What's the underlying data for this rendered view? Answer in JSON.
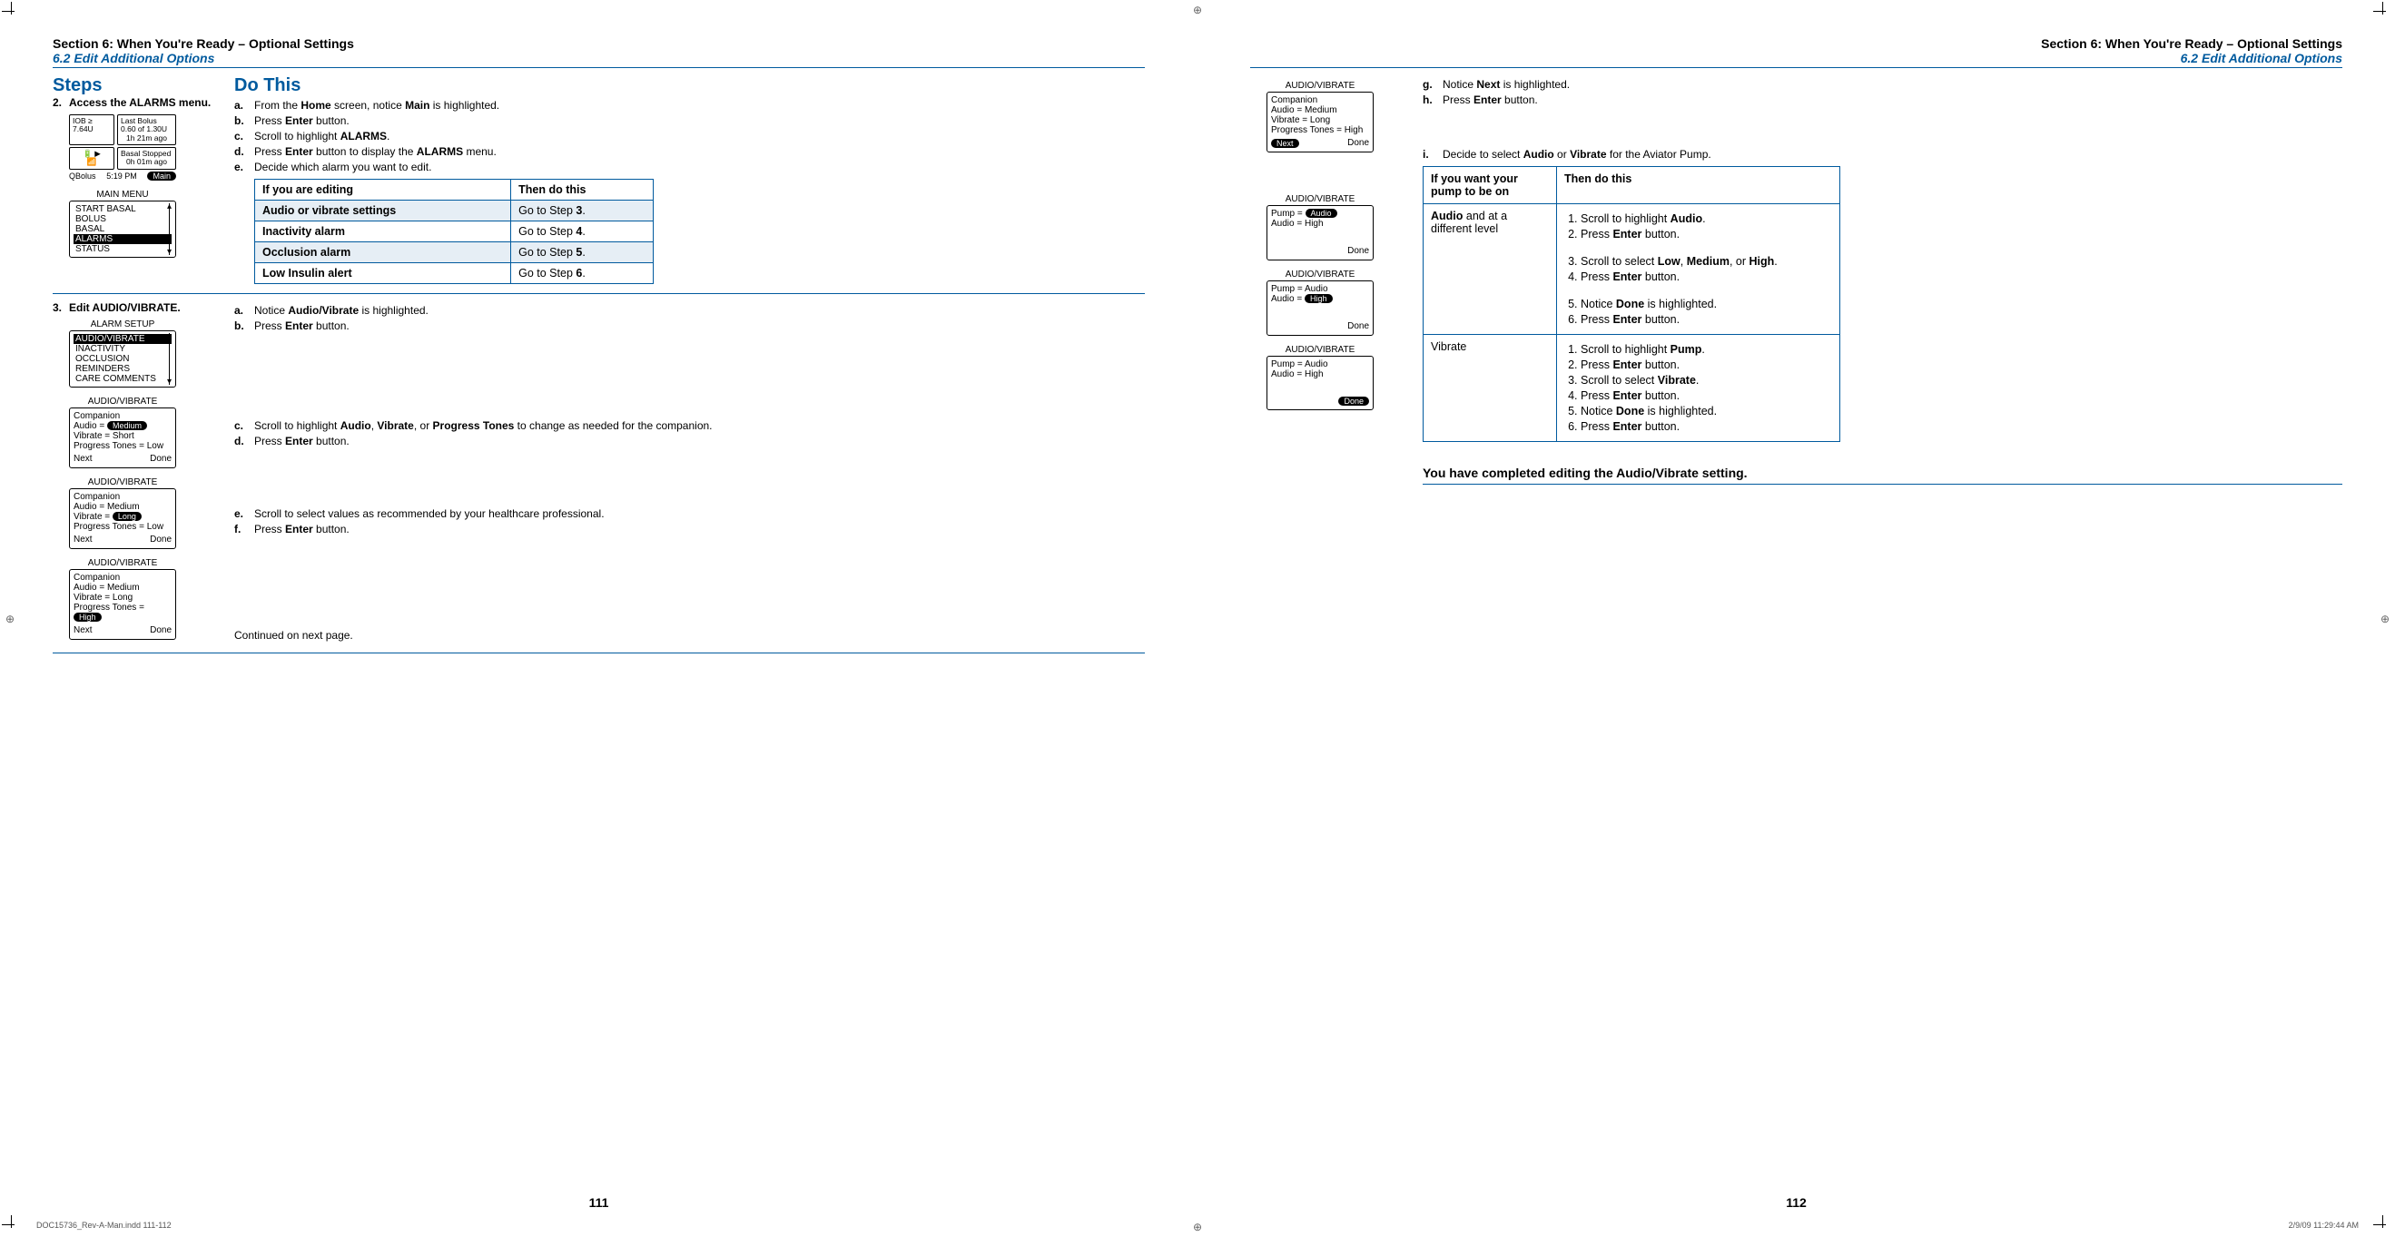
{
  "header": {
    "section": "Section 6: When You're Ready – Optional Settings",
    "subsection": "6.2 Edit Additional Options"
  },
  "left_page": {
    "steps_heading": "Steps",
    "dothis_heading": "Do This",
    "step2": {
      "label": "2.",
      "title": "Access the ALARMS menu.",
      "items": {
        "a": "From the |Home| screen, notice |Main| is highlighted.",
        "b": "Press |Enter| button.",
        "c": "Scroll to highlight |ALARMS|.",
        "d": "Press |Enter| button to display the |ALARMS| menu.",
        "e": "Decide which alarm you want to edit."
      },
      "table": {
        "head": [
          "If you are editing",
          "Then do this"
        ],
        "rows": [
          [
            "Audio or vibrate settings",
            "Go to Step |3|."
          ],
          [
            "Inactivity alarm",
            "Go to Step |4|."
          ],
          [
            "Occlusion alarm",
            "Go to Step |5|."
          ],
          [
            "Low Insulin alert",
            "Go to Step |6|."
          ]
        ]
      },
      "screen_home": {
        "iob_label": "IOB ≥",
        "iob_val": "7.64U",
        "last_bolus_title": "Last Bolus",
        "last_bolus_line": "0.60 of 1.30U",
        "last_bolus_time": "1h 21m ago",
        "basal_title": "Basal Stopped",
        "basal_time": "0h 01m ago",
        "footer_left": "QBolus",
        "footer_mid": "5:19 PM",
        "footer_right": "Main"
      },
      "screen_mainmenu": {
        "title": "MAIN MENU",
        "items": [
          "START BASAL",
          "BOLUS",
          "BASAL",
          "ALARMS",
          "STATUS"
        ],
        "selected_index": 3
      }
    },
    "step3": {
      "label": "3.",
      "title": "Edit AUDIO/VIBRATE.",
      "items1": {
        "a": "Notice |Audio/Vibrate| is highlighted.",
        "b": "Press |Enter| button."
      },
      "items2": {
        "c": "Scroll to highlight |Audio|, |Vibrate|, or |Progress Tones| to change as needed for the companion.",
        "d": "Press |Enter| button."
      },
      "items3": {
        "e": "Scroll to select values as recommended by your healthcare professional.",
        "f": "Press |Enter| button."
      },
      "continued": "Continued on next page.",
      "screen_alarm_setup": {
        "title": "ALARM SETUP",
        "items": [
          "AUDIO/VIBRATE",
          "INACTIVITY",
          "OCCLUSION",
          "REMINDERS",
          "CARE COMMENTS"
        ],
        "selected_index": 0
      },
      "screen_av1": {
        "title": "AUDIO/VIBRATE",
        "lines": [
          "Companion",
          "Audio = |Medium|",
          "Vibrate = Short",
          "Progress Tones = Low"
        ],
        "sel_idx": 1,
        "footer": [
          "Next",
          "Done"
        ]
      },
      "screen_av2": {
        "title": "AUDIO/VIBRATE",
        "lines": [
          "Companion",
          "Audio = Medium",
          "Vibrate = |Long|",
          "Progress Tones = Low"
        ],
        "sel_idx": 2,
        "footer": [
          "Next",
          "Done"
        ]
      },
      "screen_av3": {
        "title": "AUDIO/VIBRATE",
        "lines": [
          "Companion",
          "Audio = Medium",
          "Vibrate = Long",
          "Progress Tones = |High|"
        ],
        "sel_idx": 3,
        "footer": [
          "Next",
          "Done"
        ]
      }
    },
    "page_number": "111"
  },
  "right_page": {
    "screens": {
      "s1": {
        "title": "AUDIO/VIBRATE",
        "lines": [
          "Companion",
          "Audio = Medium",
          "Vibrate = Long",
          "Progress Tones = High"
        ],
        "footer_left_pill": "Next",
        "footer_right": "Done"
      },
      "s2": {
        "title": "AUDIO/VIBRATE",
        "pump_line": "Pump = |Audio|",
        "audio_line": "Audio = High",
        "footer_right": "Done"
      },
      "s3": {
        "title": "AUDIO/VIBRATE",
        "pump_line": "Pump = Audio",
        "audio_line": "Audio = |High|",
        "footer_right": "Done"
      },
      "s4": {
        "title": "AUDIO/VIBRATE",
        "pump_line": "Pump = Audio",
        "audio_line": "Audio = High",
        "footer_right_pill": "Done"
      }
    },
    "items_gh": {
      "g": "Notice |Next| is highlighted.",
      "h": "Press |Enter| button."
    },
    "item_i": {
      "k": "i.",
      "text": "Decide to select |Audio| or |Vibrate| for the Aviator Pump."
    },
    "table": {
      "head": [
        "If you want  your pump to be on",
        "Then do this"
      ],
      "row1": {
        "cond": "|Audio| and at a different level",
        "steps": [
          "Scroll to highlight |Audio|.",
          "Press |Enter| button.",
          "",
          "Scroll to select |Low|, |Medium|, or |High|.",
          "Press |Enter| button.",
          "",
          "Notice |Done| is highlighted.",
          "Press |Enter| button."
        ]
      },
      "row2": {
        "cond": "Vibrate",
        "steps": [
          "Scroll to highlight |Pump|.",
          "Press |Enter| button.",
          "Scroll to select |Vibrate|.",
          "Press |Enter| button.",
          "Notice |Done| is highlighted.",
          "Press |Enter| button."
        ]
      }
    },
    "completed": "You have completed editing the Audio/Vibrate setting.",
    "page_number": "112"
  },
  "footer": {
    "slug_left": "DOC15736_Rev-A-Man.indd   111-112",
    "slug_right": "2/9/09   11:29:44 AM"
  }
}
